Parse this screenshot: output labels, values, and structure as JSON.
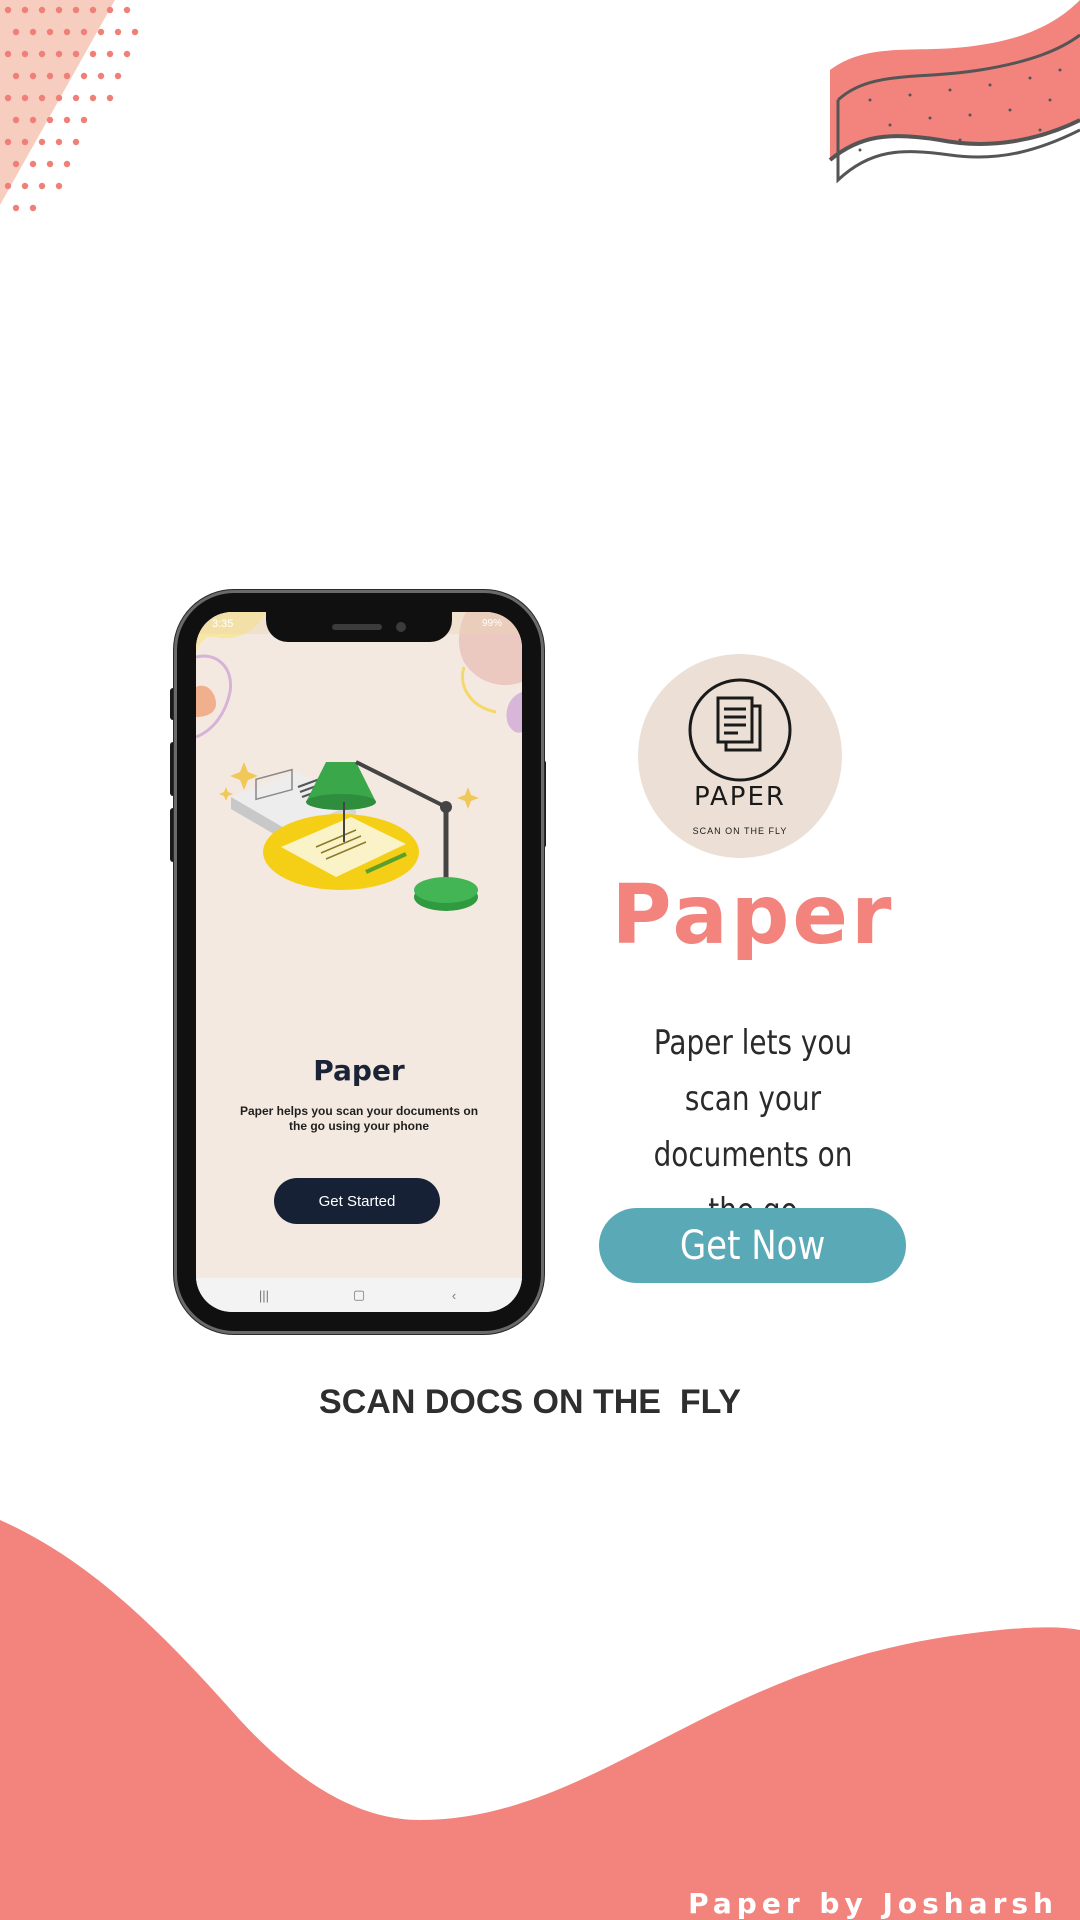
{
  "colors": {
    "accent": "#f2837d",
    "button_teal": "#5aa9b7",
    "navy": "#162136",
    "screen_bg": "#f4e9e0"
  },
  "phone": {
    "status_time": "3:35",
    "status_right": "99%",
    "screen": {
      "title": "Paper",
      "description": "Paper helps you scan your documents on the go using your phone",
      "button_label": "Get Started"
    },
    "nav": {
      "recents_icon": "recents-icon",
      "home_icon": "home-icon",
      "back_icon": "back-icon"
    }
  },
  "logo": {
    "name": "PAPER",
    "tagline": "SCAN ON THE FLY",
    "icon": "documents-icon"
  },
  "hero": {
    "title": "Paper",
    "description": "Paper lets you scan your documents on the go",
    "button_label": "Get Now"
  },
  "tagline": "SCAN DOCS ON THE  FLY",
  "credit": "Paper by Josharsh"
}
